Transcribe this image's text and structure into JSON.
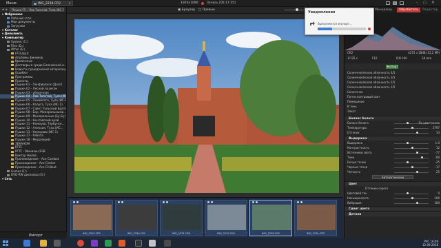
{
  "app": {
    "menu_label": "Меню",
    "tab_title": "IMG_2238.CR2",
    "resolution": "1920x1080",
    "record_label": "Запись [00:17:35]"
  },
  "left_panel": {
    "path": "Пушки (T) › Лев Толстой, Тула (ИС-1)",
    "tree": [
      {
        "label": "Избранное",
        "type": "section"
      },
      {
        "label": "Рабочий стол",
        "type": "blue"
      },
      {
        "label": "Мои документы",
        "type": "blue"
      },
      {
        "label": "Загрузки",
        "type": "blue"
      },
      {
        "label": "Каталог",
        "type": "section"
      },
      {
        "label": "Дополнить",
        "type": "section"
      },
      {
        "label": "Компьютер",
        "type": "section"
      },
      {
        "label": "System (C:)",
        "type": "gray"
      },
      {
        "label": "Files (D:)",
        "type": "gray"
      },
      {
        "label": "Other (E:)",
        "type": "gray"
      },
      {
        "label": "FFOutput",
        "type": "folder"
      },
      {
        "label": "Альбомы фиников",
        "type": "folder"
      },
      {
        "label": "Временные",
        "type": "folder"
      },
      {
        "label": "Дестворы в среде Балковской и...",
        "type": "folder"
      },
      {
        "label": "Новость гражданской авторизац...",
        "type": "folder"
      },
      {
        "label": "Ошибки",
        "type": "folder"
      },
      {
        "label": "Программы",
        "type": "folder"
      },
      {
        "label": "Проекты",
        "type": "folder"
      },
      {
        "label": "Пушки 01 - Панфирянск (Долг)",
        "type": "folder"
      },
      {
        "label": "Пушки 02 - Лесной полигон",
        "type": "folder"
      },
      {
        "label": "Пушки 03 - уборочная",
        "type": "folder"
      },
      {
        "label": "Пушки 04 - Лев Толстой, Тула (ИС-1)",
        "type": "selected"
      },
      {
        "label": "Пушки 05 - Похвйлого, Тула (ИС-1)",
        "type": "folder"
      },
      {
        "label": "Пушки 06 - Калуга, Тула (ИС-1)",
        "type": "folder"
      },
      {
        "label": "Пушки 07 - Совет Тульский Брата",
        "type": "folder"
      },
      {
        "label": "Пушки 08 - Бор, Минеральными...",
        "type": "folder"
      },
      {
        "label": "Пушки 09 - Минеральные (Бу-Бу)",
        "type": "folder"
      },
      {
        "label": "Пушки 10 - Кентовский край",
        "type": "folder"
      },
      {
        "label": "Пушки 11 - Кемеров, Тербунск...",
        "type": "folder"
      },
      {
        "label": "Пушки 12 - Алексия, Тула (ИС...",
        "type": "folder"
      },
      {
        "label": "Пушки 13 - Кемерово (ИС-1)",
        "type": "folder"
      },
      {
        "label": "Пушки 17 - Работа",
        "type": "folder"
      },
      {
        "label": "Пушки 18 - Медалерий",
        "type": "folder"
      },
      {
        "label": "ЗЕКАНОМ",
        "type": "folder"
      },
      {
        "label": "RTTC",
        "type": "folder"
      },
      {
        "label": "RTTC - Минизин ЯЗВ",
        "type": "folder"
      },
      {
        "label": "Виктор Нилов",
        "type": "folder"
      },
      {
        "label": "Пропожидение - Асе Combat",
        "type": "folder"
      },
      {
        "label": "Прохождение - Асе Сeeker",
        "type": "folder"
      },
      {
        "label": "Прохождение - Асе Сhillout",
        "type": "folder"
      },
      {
        "label": "Games (F:)",
        "type": "gray"
      },
      {
        "label": "DVD-RW дисковод (G:)",
        "type": "gray"
      },
      {
        "label": "Сеть",
        "type": "section"
      }
    ],
    "import_label": "Импорт"
  },
  "viewer": {
    "btn_brown": "Браузер",
    "btn_view": "Превью",
    "zoom": "28 %"
  },
  "filmstrip": {
    "items": [
      {
        "name": "IMG_2220.CR2",
        "color": "#8a6a54"
      },
      {
        "name": "IMG_2230.CR2",
        "color": "#3c3c3c"
      },
      {
        "name": "IMG_2231.CR2",
        "color": "#2f3b3c"
      },
      {
        "name": "IMG_2232.CR2",
        "color": "#7c8a98"
      },
      {
        "name": "IMG_2238.CR2",
        "color": "#5c7a6a"
      },
      {
        "name": "IMG_2239.CR2",
        "color": "#7b5a48"
      }
    ]
  },
  "right_panel": {
    "tab_manager": "Менеджер",
    "tab_process": "Обработать",
    "tab_edit": "Редактор",
    "camera": {
      "model": "CR2",
      "dims": "4272 x 2848 (12,2 MP)",
      "shutter": "1/125 s",
      "fstop": "F10",
      "iso": "ISO 200",
      "focal": "18 mm"
    },
    "presets": [
      "Солнечное/ясная облачность 4/5",
      "Солнечное/ясная облачность 3/5",
      "Солнечное/ясная облачность 2/5",
      "Солнечное/ясная облачность 1/5",
      "Солнечное",
      "Почти контровый свет",
      "Помещение",
      "В тень",
      "Закат"
    ],
    "export_label": "Экспорт",
    "sections": {
      "wb": "Баланс белого",
      "exposure": "Выдержка",
      "color": "Цвет",
      "split": "Сдвиг цвета",
      "details": "Детали"
    },
    "wb": [
      {
        "label": "Баланс белого",
        "value": "По умолчанию"
      },
      {
        "label": "Температура",
        "value": "5797"
      },
      {
        "label": "Оттенок",
        "value": "33"
      }
    ],
    "exposure": [
      {
        "label": "Выдержка",
        "value": "1.0"
      },
      {
        "label": "Контрастность",
        "value": "12"
      },
      {
        "label": "Источники света",
        "value": "-77"
      },
      {
        "label": "Тени",
        "value": "-90"
      },
      {
        "label": "Белые точки",
        "value": "-25"
      },
      {
        "label": "Черные точки",
        "value": "-17"
      },
      {
        "label": "Четкость",
        "value": "25"
      }
    ],
    "auto_label": "Автоматически",
    "color": [
      {
        "label": "Цветовой тон",
        "value": "0"
      },
      {
        "label": "Насыщенность",
        "value": "100"
      },
      {
        "label": "Вибрация",
        "value": "100"
      }
    ],
    "color_mode": "Оттенки серого"
  },
  "notification": {
    "title": "Уведомления",
    "message": "Выполняется экспорт...",
    "progress": 0.3
  },
  "taskbar": {
    "time": "16:09",
    "date": "12.09.2018",
    "lang": "РУС"
  }
}
